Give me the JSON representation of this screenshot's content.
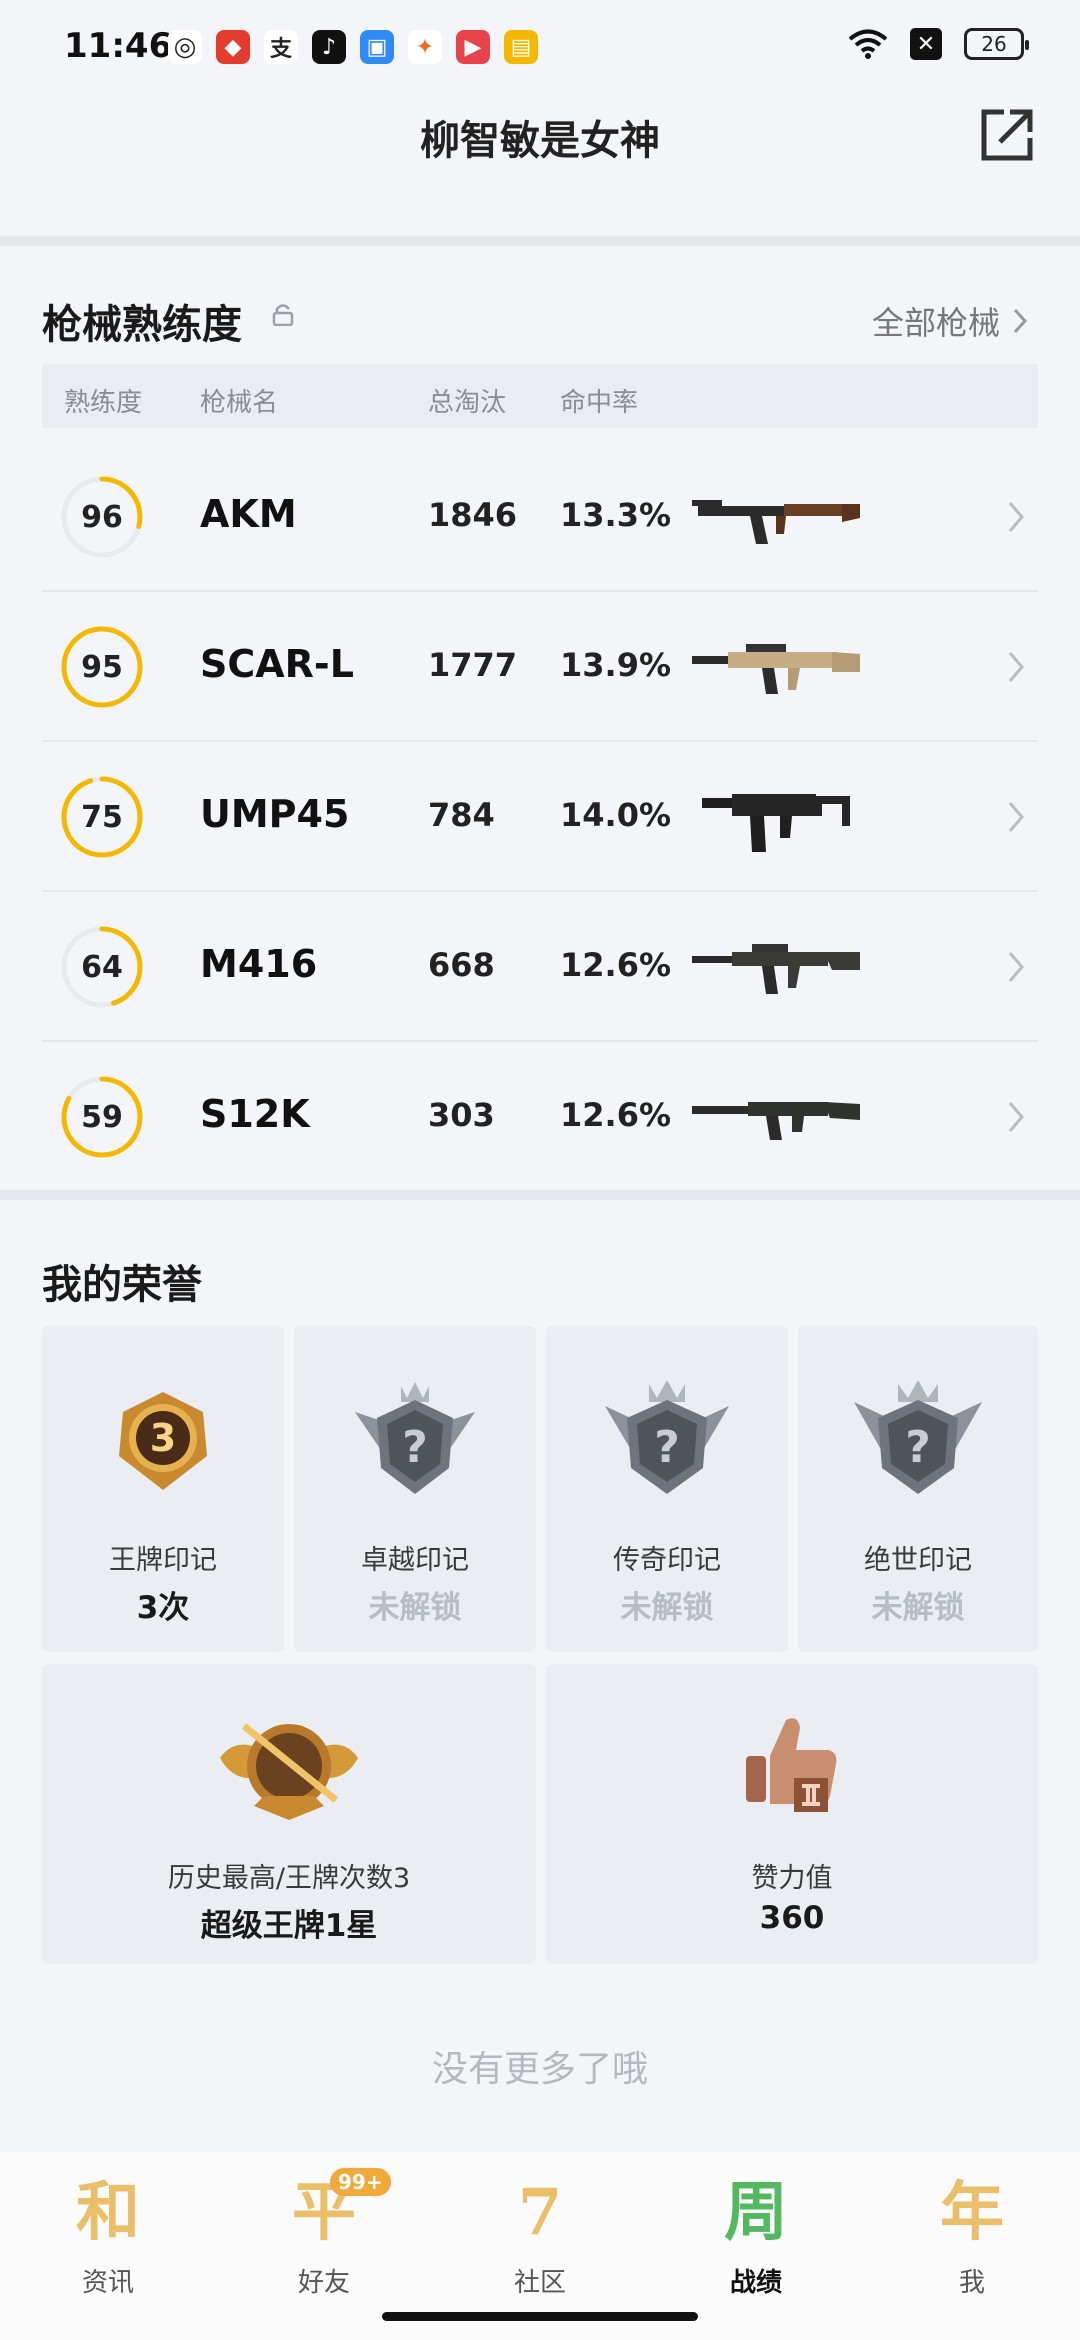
{
  "status_bar": {
    "time": "11:46",
    "battery": "26"
  },
  "header": {
    "title": "柳智敏是女神"
  },
  "weapons": {
    "title": "枪械熟练度",
    "all_link": "全部枪械",
    "columns": {
      "proficiency": "熟练度",
      "name": "枪械名",
      "kills": "总淘汰",
      "hit_rate": "命中率"
    },
    "rows": [
      {
        "proficiency": "96",
        "proficiency_value": 0.29,
        "name": "AKM",
        "kills": "1846",
        "hit_rate": "13.3%"
      },
      {
        "proficiency": "95",
        "proficiency_value": 0.99,
        "name": "SCAR-L",
        "kills": "1777",
        "hit_rate": "13.9%"
      },
      {
        "proficiency": "75",
        "proficiency_value": 0.95,
        "name": "UMP45",
        "kills": "784",
        "hit_rate": "14.0%"
      },
      {
        "proficiency": "64",
        "proficiency_value": 0.45,
        "name": "M416",
        "kills": "668",
        "hit_rate": "12.6%"
      },
      {
        "proficiency": "59",
        "proficiency_value": 0.83,
        "name": "S12K",
        "kills": "303",
        "hit_rate": "12.6%"
      }
    ]
  },
  "honors": {
    "title": "我的荣誉",
    "cards": [
      {
        "label": "王牌印记",
        "value": "3次",
        "badge_number": "3",
        "locked": false
      },
      {
        "label": "卓越印记",
        "value": "未解锁",
        "locked": true
      },
      {
        "label": "传奇印记",
        "value": "未解锁",
        "locked": true
      },
      {
        "label": "绝世印记",
        "value": "未解锁",
        "locked": true
      }
    ],
    "wide_cards": [
      {
        "label": "历史最高/王牌次数3",
        "value": "超级王牌1星"
      },
      {
        "label": "赞力值",
        "value": "360"
      }
    ]
  },
  "footer": {
    "no_more": "没有更多了哦"
  },
  "nav": {
    "items": [
      {
        "glyph": "和",
        "label": "资讯"
      },
      {
        "glyph": "平",
        "label": "好友",
        "badge": "99+"
      },
      {
        "glyph": "7",
        "label": "社区"
      },
      {
        "glyph": "周",
        "label": "战绩"
      },
      {
        "glyph": "年",
        "label": "我"
      }
    ]
  },
  "colors": {
    "accent": "#f5b800",
    "ring_track": "#e8eaee",
    "nav_gold": "#e9bf6a",
    "nav_active": "#53b860"
  }
}
